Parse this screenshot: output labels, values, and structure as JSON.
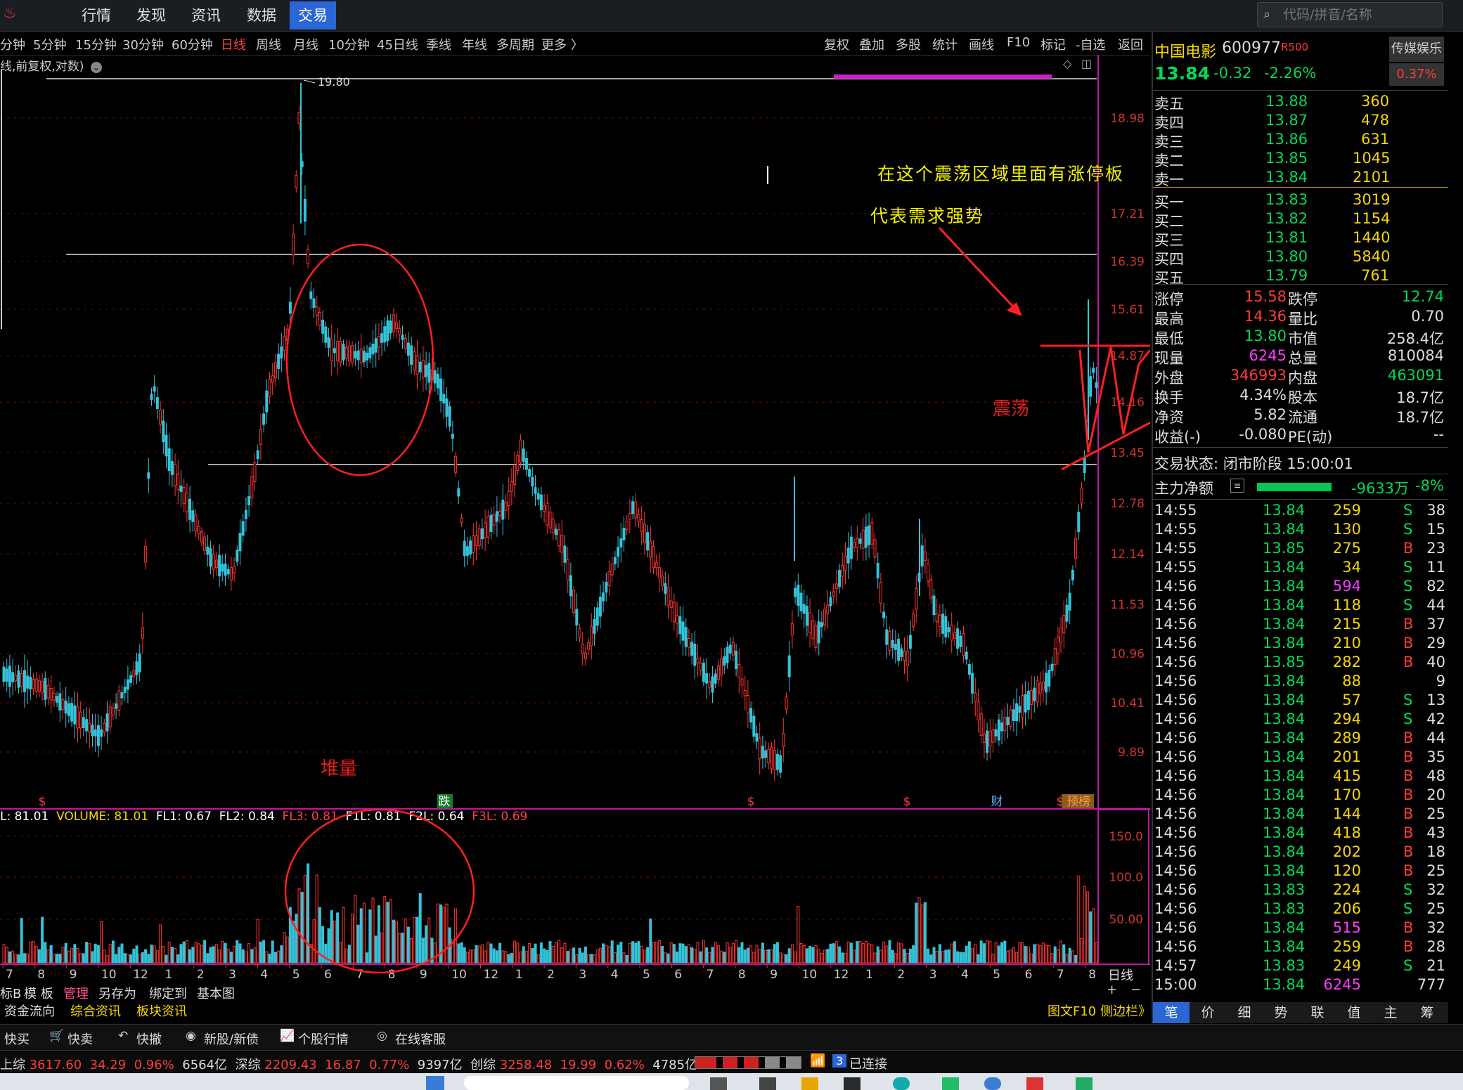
{
  "menu": {
    "items": [
      "行情",
      "发现",
      "资讯",
      "数据",
      "交易"
    ],
    "active": 4
  },
  "search": {
    "placeholder": "代码/拼音/名称"
  },
  "periods": {
    "items": [
      "分钟",
      "5分钟",
      "15分钟",
      "30分钟",
      "60分钟",
      "日线",
      "周线",
      "月线",
      "10分钟",
      "45日线",
      "季线",
      "年线",
      "多周期",
      "更多 〉"
    ],
    "active": 5
  },
  "chart_tools": [
    "复权",
    "叠加",
    "多股",
    "统计",
    "画线",
    "F10",
    "标记",
    "-自选",
    "返回"
  ],
  "chart_title": "线,前复权,对数)",
  "chart_data": {
    "type": "candlestick",
    "price_axis_ticks": [
      "18.98",
      "17.21",
      "16.39",
      "15.61",
      "14.87",
      "14.16",
      "13.45",
      "12.78",
      "12.14",
      "11.53",
      "10.96",
      "10.41",
      "9.89"
    ],
    "high_label": "19.80",
    "volume_axis_ticks": [
      "150.0",
      "100.0",
      "50.00"
    ],
    "x_axis_labels": [
      "7",
      "8",
      "9",
      "10",
      "12",
      "1",
      "2",
      "3",
      "4",
      "5",
      "6",
      "7",
      "8",
      "9",
      "10",
      "12",
      "1",
      "2",
      "3",
      "4",
      "5",
      "6",
      "7",
      "8",
      "9",
      "10",
      "12",
      "1",
      "2",
      "3",
      "4",
      "5",
      "6",
      "7",
      "8"
    ],
    "markers": [
      "$",
      "跌",
      "$",
      "$",
      "财",
      "$",
      "预榜"
    ]
  },
  "annotations": {
    "note1": "在这个震荡区域里面有涨停板",
    "note2": "代表需求强势",
    "oscillation": "震荡",
    "heap_volume": "堆量"
  },
  "indicator": {
    "label": "L: 81.01",
    "volume": "VOLUME: 81.01",
    "fl1": "FL1: 0.67",
    "fl2": "FL2: 0.84",
    "fl3": "FL3: 0.81",
    "f1l": "F1L: 0.81",
    "f2l": "F2L: 0.64",
    "f3l": "F3L: 0.69"
  },
  "volume_corner": "日线",
  "bottom_tabs": [
    "标B",
    "模 板",
    "管理",
    "另存为",
    "绑定到",
    "基本图"
  ],
  "bottom_links": [
    "资金流向",
    "综合资讯",
    "板块资讯"
  ],
  "bottom_right": "图文F10 侧边栏》",
  "quick": [
    "快买",
    "快卖",
    "快撤",
    "新股/新债",
    "个股行情",
    "在线客服"
  ],
  "status": {
    "sh_name": "上综",
    "sh_val": "3617.60",
    "sh_chg": "34.29",
    "sh_pct": "0.96%",
    "sh_amt": "6564亿",
    "sz_name": "深综",
    "sz_val": "2209.43",
    "sz_chg": "16.87",
    "sz_pct": "0.77%",
    "sz_amt": "9397亿",
    "cy_name": "创综",
    "cy_val": "3258.48",
    "cy_chg": "19.99",
    "cy_pct": "0.62%",
    "cy_amt": "4785亿",
    "conn_num": "3",
    "conn": "已连接"
  },
  "stock": {
    "name": "中国电影",
    "code": "600977",
    "tag": "R500",
    "price": "13.84",
    "chg": "-0.32",
    "pct": "-2.26%",
    "sector": "传媒娱乐",
    "sector_pct": "0.37%"
  },
  "asks": [
    {
      "label": "卖五",
      "price": "13.88",
      "vol": "360"
    },
    {
      "label": "卖四",
      "price": "13.87",
      "vol": "478"
    },
    {
      "label": "卖三",
      "price": "13.86",
      "vol": "631"
    },
    {
      "label": "卖二",
      "price": "13.85",
      "vol": "1045"
    },
    {
      "label": "卖一",
      "price": "13.84",
      "vol": "2101"
    }
  ],
  "bids": [
    {
      "label": "买一",
      "price": "13.83",
      "vol": "3019"
    },
    {
      "label": "买二",
      "price": "13.82",
      "vol": "1154"
    },
    {
      "label": "买三",
      "price": "13.81",
      "vol": "1440"
    },
    {
      "label": "买四",
      "price": "13.80",
      "vol": "5840"
    },
    {
      "label": "买五",
      "price": "13.79",
      "vol": "761"
    }
  ],
  "stats": [
    {
      "l1": "涨停",
      "v1": "15.58",
      "l2": "跌停",
      "v2": "12.74"
    },
    {
      "l1": "最高",
      "v1": "14.36",
      "l2": "量比",
      "v2": "0.70"
    },
    {
      "l1": "最低",
      "v1": "13.80",
      "l2": "市值",
      "v2": "258.4亿"
    },
    {
      "l1": "现量",
      "v1": "6245",
      "l2": "总量",
      "v2": "810084"
    },
    {
      "l1": "外盘",
      "v1": "346993",
      "l2": "内盘",
      "v2": "463091"
    },
    {
      "l1": "换手",
      "v1": "4.34%",
      "l2": "股本",
      "v2": "18.7亿"
    },
    {
      "l1": "净资",
      "v1": "5.82",
      "l2": "流通",
      "v2": "18.7亿"
    },
    {
      "l1": "收益(-)",
      "v1": "-0.080",
      "l2": "PE(动)",
      "v2": "--"
    }
  ],
  "trade_state": "交易状态: 闭市阶段 15:00:01",
  "main_flow": {
    "label": "主力净额",
    "value": "-9633万",
    "pct": "-8%"
  },
  "ticks": [
    {
      "t": "14:55",
      "p": "13.84",
      "v": "259",
      "d": "S",
      "n": "38"
    },
    {
      "t": "14:55",
      "p": "13.84",
      "v": "130",
      "d": "S",
      "n": "15"
    },
    {
      "t": "14:55",
      "p": "13.85",
      "v": "275",
      "d": "B",
      "n": "23"
    },
    {
      "t": "14:55",
      "p": "13.84",
      "v": "34",
      "d": "S",
      "n": "11"
    },
    {
      "t": "14:56",
      "p": "13.84",
      "v": "594",
      "d": "S",
      "n": "82"
    },
    {
      "t": "14:56",
      "p": "13.84",
      "v": "118",
      "d": "S",
      "n": "44"
    },
    {
      "t": "14:56",
      "p": "13.84",
      "v": "215",
      "d": "B",
      "n": "37"
    },
    {
      "t": "14:56",
      "p": "13.84",
      "v": "210",
      "d": "B",
      "n": "29"
    },
    {
      "t": "14:56",
      "p": "13.85",
      "v": "282",
      "d": "B",
      "n": "40"
    },
    {
      "t": "14:56",
      "p": "13.84",
      "v": "88",
      "d": "",
      "n": "9"
    },
    {
      "t": "14:56",
      "p": "13.84",
      "v": "57",
      "d": "S",
      "n": "13"
    },
    {
      "t": "14:56",
      "p": "13.84",
      "v": "294",
      "d": "S",
      "n": "42"
    },
    {
      "t": "14:56",
      "p": "13.84",
      "v": "289",
      "d": "B",
      "n": "44"
    },
    {
      "t": "14:56",
      "p": "13.84",
      "v": "201",
      "d": "B",
      "n": "35"
    },
    {
      "t": "14:56",
      "p": "13.84",
      "v": "415",
      "d": "B",
      "n": "48"
    },
    {
      "t": "14:56",
      "p": "13.84",
      "v": "170",
      "d": "B",
      "n": "20"
    },
    {
      "t": "14:56",
      "p": "13.84",
      "v": "144",
      "d": "B",
      "n": "25"
    },
    {
      "t": "14:56",
      "p": "13.84",
      "v": "418",
      "d": "B",
      "n": "43"
    },
    {
      "t": "14:56",
      "p": "13.84",
      "v": "202",
      "d": "B",
      "n": "18"
    },
    {
      "t": "14:56",
      "p": "13.84",
      "v": "120",
      "d": "B",
      "n": "25"
    },
    {
      "t": "14:56",
      "p": "13.83",
      "v": "224",
      "d": "S",
      "n": "32"
    },
    {
      "t": "14:56",
      "p": "13.83",
      "v": "206",
      "d": "S",
      "n": "25"
    },
    {
      "t": "14:56",
      "p": "13.84",
      "v": "515",
      "d": "B",
      "n": "32"
    },
    {
      "t": "14:56",
      "p": "13.84",
      "v": "259",
      "d": "B",
      "n": "28"
    },
    {
      "t": "14:57",
      "p": "13.83",
      "v": "249",
      "d": "S",
      "n": "21"
    },
    {
      "t": "15:00",
      "p": "13.84",
      "v": "6245",
      "d": "",
      "n": "777"
    }
  ],
  "panel_tabs": [
    "笔",
    "价",
    "细",
    "势",
    "联",
    "值",
    "主",
    "筹"
  ],
  "panel_tabs_active": 0
}
